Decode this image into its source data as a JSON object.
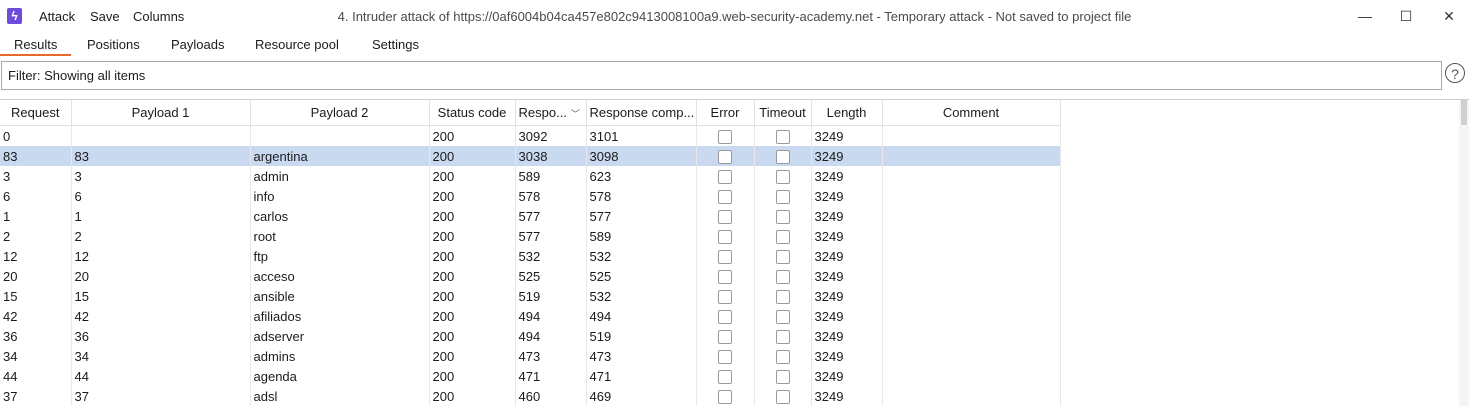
{
  "window": {
    "title": "4. Intruder attack of https://0af6004b04ca457e802c9413008100a9.web-security-academy.net - Temporary attack - Not saved to project file",
    "app_icon": "burp-lightning-icon",
    "menu": [
      "Attack",
      "Save",
      "Columns"
    ],
    "controls": {
      "minimize": "—",
      "maximize": "☐",
      "close": "✕"
    }
  },
  "tabs": [
    "Results",
    "Positions",
    "Payloads",
    "Resource pool",
    "Settings"
  ],
  "active_tab": "Results",
  "accent_color": "#e8692b",
  "filter": {
    "text": "Filter: Showing all items",
    "help": "?"
  },
  "table": {
    "columns": [
      "Request",
      "Payload 1",
      "Payload 2",
      "Status code",
      "Respo...",
      "Response comp...",
      "Error",
      "Timeout",
      "Length",
      "Comment"
    ],
    "sorted_column": "Respo...",
    "selected_row": 1,
    "rows": [
      [
        "0",
        "",
        "",
        "200",
        "3092",
        "3101",
        "3249"
      ],
      [
        "83",
        "83",
        "argentina",
        "200",
        "3038",
        "3098",
        "3249"
      ],
      [
        "3",
        "3",
        "admin",
        "200",
        "589",
        "623",
        "3249"
      ],
      [
        "6",
        "6",
        "info",
        "200",
        "578",
        "578",
        "3249"
      ],
      [
        "1",
        "1",
        "carlos",
        "200",
        "577",
        "577",
        "3249"
      ],
      [
        "2",
        "2",
        "root",
        "200",
        "577",
        "589",
        "3249"
      ],
      [
        "12",
        "12",
        "ftp",
        "200",
        "532",
        "532",
        "3249"
      ],
      [
        "20",
        "20",
        "acceso",
        "200",
        "525",
        "525",
        "3249"
      ],
      [
        "15",
        "15",
        "ansible",
        "200",
        "519",
        "532",
        "3249"
      ],
      [
        "42",
        "42",
        "afiliados",
        "200",
        "494",
        "494",
        "3249"
      ],
      [
        "36",
        "36",
        "adserver",
        "200",
        "494",
        "519",
        "3249"
      ],
      [
        "34",
        "34",
        "admins",
        "200",
        "473",
        "473",
        "3249"
      ],
      [
        "44",
        "44",
        "agenda",
        "200",
        "471",
        "471",
        "3249"
      ],
      [
        "37",
        "37",
        "adsl",
        "200",
        "460",
        "469",
        "3249"
      ]
    ]
  }
}
